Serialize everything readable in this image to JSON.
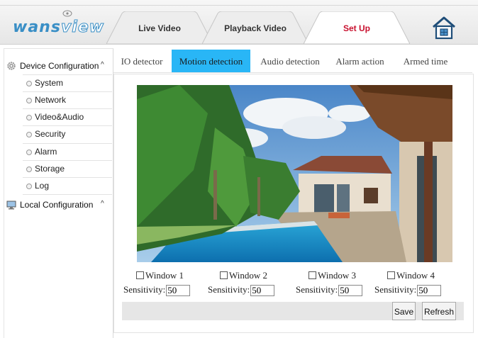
{
  "header": {
    "logo_text_a": "wans",
    "logo_text_b": "view",
    "tabs": [
      {
        "label": "Live Video"
      },
      {
        "label": "Playback Video"
      },
      {
        "label": "Set Up",
        "active": true
      }
    ],
    "home_icon": "home-icon"
  },
  "sidebar": {
    "groups": [
      {
        "label": "Device Configuration",
        "icon": "gear-icon",
        "expanded": true,
        "items": [
          {
            "label": "System"
          },
          {
            "label": "Network"
          },
          {
            "label": "Video&Audio"
          },
          {
            "label": "Security"
          },
          {
            "label": "Alarm"
          },
          {
            "label": "Storage"
          },
          {
            "label": "Log"
          }
        ]
      },
      {
        "label": "Local Configuration",
        "icon": "monitor-icon",
        "expanded": false
      }
    ],
    "caret": "^"
  },
  "subtabs": [
    {
      "label": "IO detector"
    },
    {
      "label": "Motion detection",
      "active": true
    },
    {
      "label": "Audio detection"
    },
    {
      "label": "Alarm action"
    },
    {
      "label": "Armed time"
    }
  ],
  "motion": {
    "windows": [
      {
        "label": "Window 1",
        "checked": false,
        "sensitivity_label": "Sensitivity:",
        "sensitivity": "50"
      },
      {
        "label": "Window 2",
        "checked": false,
        "sensitivity_label": "Sensitivity:",
        "sensitivity": "50"
      },
      {
        "label": "Window 3",
        "checked": false,
        "sensitivity_label": "Sensitivity:",
        "sensitivity": "50"
      },
      {
        "label": "Window 4",
        "checked": false,
        "sensitivity_label": "Sensitivity:",
        "sensitivity": "50"
      }
    ],
    "save_label": "Save",
    "refresh_label": "Refresh"
  },
  "colors": {
    "accent": "#29b6f6",
    "active_nav_text": "#c8102e",
    "logo": "#3a8fc6"
  }
}
